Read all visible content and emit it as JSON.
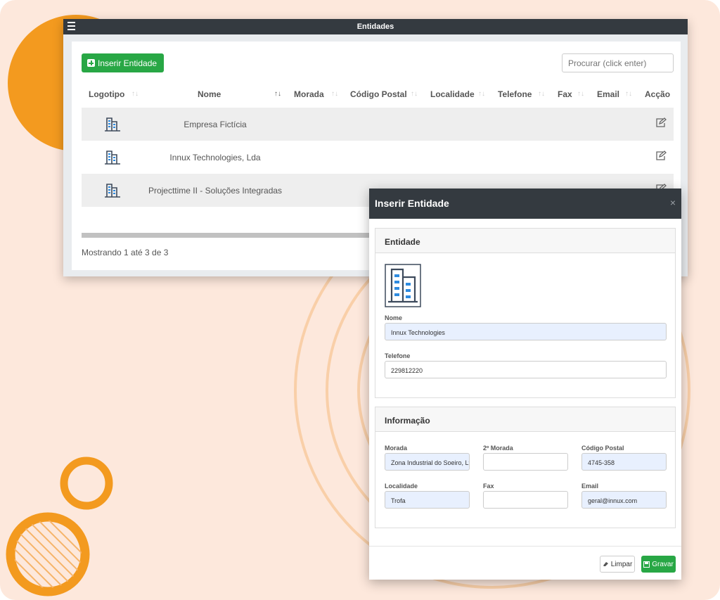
{
  "window": {
    "title": "Entidades",
    "menu_icon": "hamburger-icon"
  },
  "toolbar": {
    "insert_label": "Inserir Entidade",
    "search_placeholder": "Procurar (click enter)"
  },
  "table": {
    "columns": [
      "Logotipo",
      "Nome",
      "Morada",
      "Código Postal",
      "Localidade",
      "Telefone",
      "Fax",
      "Email",
      "Acção"
    ],
    "rows": [
      {
        "logo": "building-icon",
        "name": "Empresa Fictícia",
        "action": "edit-icon"
      },
      {
        "logo": "building-icon",
        "name": "Innux Technologies, Lda",
        "action": "edit-icon"
      },
      {
        "logo": "building-icon",
        "name": "Projecttime II - Soluções Integradas",
        "action": "edit-icon"
      }
    ],
    "info": "Mostrando 1 até 3 de 3"
  },
  "modal": {
    "title": "Inserir Entidade",
    "close": "×",
    "entidade": {
      "header": "Entidade",
      "nome_label": "Nome",
      "nome_value": "Innux Technologies",
      "telefone_label": "Telefone",
      "telefone_value": "229812220"
    },
    "informacao": {
      "header": "Informação",
      "morada_label": "Morada",
      "morada_value": "Zona Industrial do Soeiro, Lt",
      "morada2_label": "2º Morada",
      "morada2_value": "",
      "cp_label": "Código Postal",
      "cp_value": "4745-358",
      "localidade_label": "Localidade",
      "localidade_value": "Trofa",
      "fax_label": "Fax",
      "fax_value": "",
      "email_label": "Email",
      "email_value": "geral@innux.com"
    },
    "footer": {
      "clear_label": "Limpar",
      "save_label": "Gravar"
    }
  },
  "colors": {
    "accent": "#28a745",
    "header": "#343a40",
    "background": "#fde8dc",
    "decoration": "#f39a1f"
  }
}
